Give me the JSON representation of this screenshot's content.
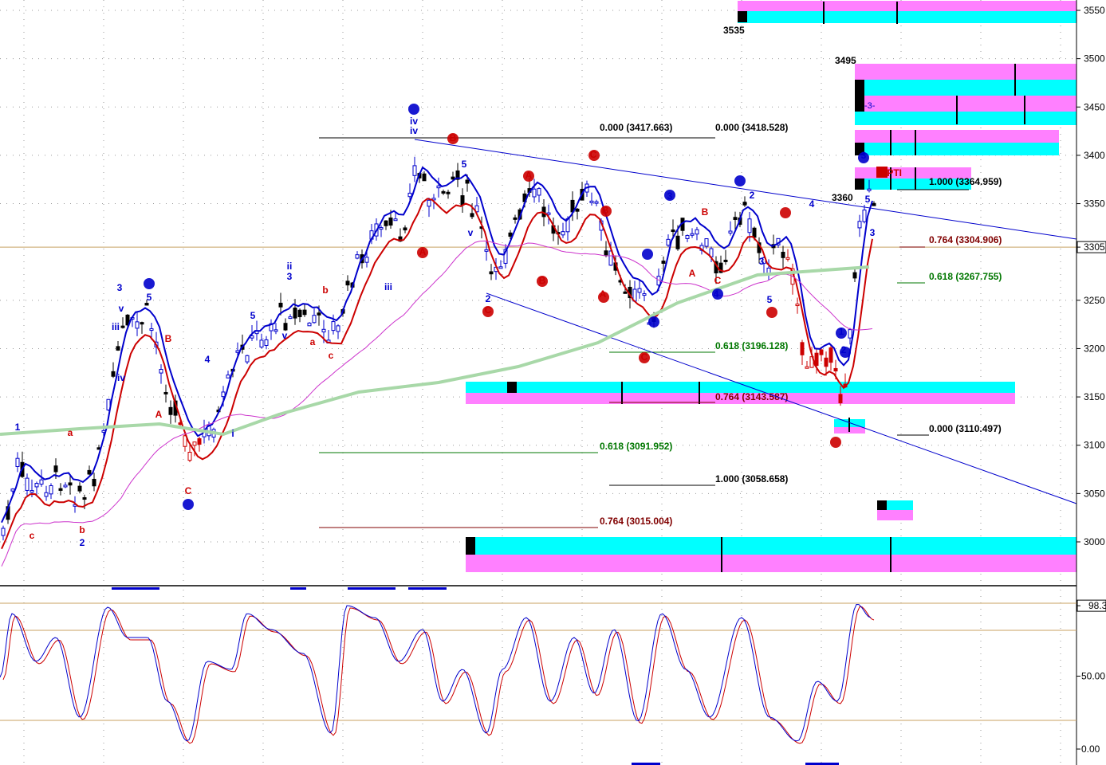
{
  "chart_data": {
    "type": "line",
    "price_axis": {
      "ticks": [
        "3550",
        "3500",
        "3450",
        "3400",
        "3350",
        "3305",
        "3250",
        "3200",
        "3150",
        "3100",
        "3050",
        "3000"
      ],
      "current_price_label": "3305",
      "ylim": [
        2970,
        3560
      ]
    },
    "oscillator_axis": {
      "ticks": [
        "98.3",
        "50.00",
        "0.00"
      ],
      "ylim": [
        0,
        100
      ]
    },
    "fib_levels": [
      {
        "label": "0.000 (3417.663)",
        "price": 3417.663,
        "color": "#000000"
      },
      {
        "label": "0.000 (3418.528)",
        "price": 3418.528,
        "color": "#000000"
      },
      {
        "label": "1.000 (3364.959)",
        "price": 3364.959,
        "color": "#000000"
      },
      {
        "label": "0.764 (3304.906)",
        "price": 3304.906,
        "color": "#800000"
      },
      {
        "label": "0.618 (3267.755)",
        "price": 3267.755,
        "color": "#007700"
      },
      {
        "label": "0.618 (3196.128)",
        "price": 3196.128,
        "color": "#007700"
      },
      {
        "label": "0.764 (3143.587)",
        "price": 3143.587,
        "color": "#800000"
      },
      {
        "label": "0.000 (3110.497)",
        "price": 3110.497,
        "color": "#000000"
      },
      {
        "label": "0.618 (3091.952)",
        "price": 3091.952,
        "color": "#007700"
      },
      {
        "label": "1.000 (3058.658)",
        "price": 3058.658,
        "color": "#000000"
      },
      {
        "label": "0.764 (3015.004)",
        "price": 3015.004,
        "color": "#800000"
      }
    ],
    "price_annotations": [
      "3535",
      "3495",
      "3360",
      "-3-",
      "65PTI"
    ],
    "wave_labels_blue": [
      "1",
      "3",
      "5",
      "iii",
      "iv",
      "v",
      "2",
      "4",
      "i",
      "ii",
      "3",
      "5",
      "v",
      "iii",
      "iv",
      "iv",
      "5",
      "v",
      "2",
      "3",
      "3",
      "5",
      "2",
      "4",
      "3",
      "5",
      "1",
      "2",
      "3",
      "4"
    ],
    "wave_labels_red": [
      "a",
      "b",
      "c",
      "A",
      "B",
      "C",
      "a",
      "b",
      "c",
      "A",
      "B",
      "C",
      "A",
      "B",
      "C",
      "A",
      "B",
      "C",
      "A",
      "B",
      "C"
    ],
    "colors": {
      "cyan_zone": "#00ffff",
      "magenta_zone": "#ff80ff",
      "ma_fast": "#0000cc",
      "ma_slow": "#cc0000",
      "ma_magenta": "#cc33cc",
      "ma_long": "#a8d8a8",
      "stoch_k": "#0000cc",
      "stoch_d": "#cc0000"
    }
  }
}
